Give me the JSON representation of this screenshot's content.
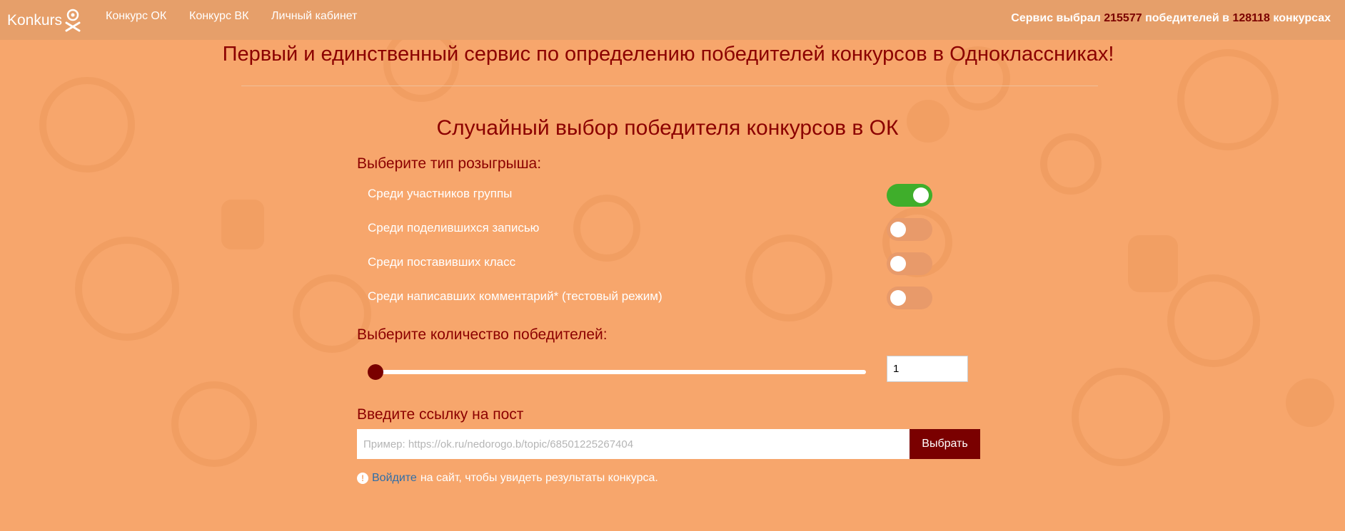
{
  "header": {
    "logo_text": "Konkurs",
    "nav": [
      {
        "label": "Конкурс ОК"
      },
      {
        "label": "Конкурс ВК"
      },
      {
        "label": "Личный кабинет"
      }
    ],
    "stats": {
      "prefix": "Сервис выбрал",
      "winners": "215577",
      "middle": "победителей в",
      "contests": "128118",
      "suffix": "конкурсах"
    }
  },
  "main": {
    "headline": "Первый и единственный сервис по определению победителей конкурсов в Одноклассниках!",
    "section_title": "Случайный выбор победителя конкурсов в ОК",
    "type_label": "Выберите тип розыгрыша:",
    "options": [
      {
        "label": "Среди участников группы",
        "enabled": true
      },
      {
        "label": "Среди поделившихся записью",
        "enabled": false
      },
      {
        "label": "Среди поставивших класс",
        "enabled": false
      },
      {
        "label": "Среди написавших комментарий* (тестовый режим)",
        "enabled": false
      }
    ],
    "count_label": "Выберите количество победителей:",
    "count_value": "1",
    "post_label": "Введите ссылку на пост",
    "post_placeholder": "Пример: https://ok.ru/nedorogo.b/topic/68501225267404",
    "choose_button": "Выбрать",
    "notice": {
      "link": "Войдите",
      "text": "на сайт, чтобы увидеть результаты конкурса."
    }
  },
  "colors": {
    "background": "#f7a66c",
    "accent": "#8b0000",
    "toggle_on": "#3fae2b"
  },
  "icons": {
    "logo": "gift-box-icon",
    "notice": "exclamation-circle-icon"
  }
}
